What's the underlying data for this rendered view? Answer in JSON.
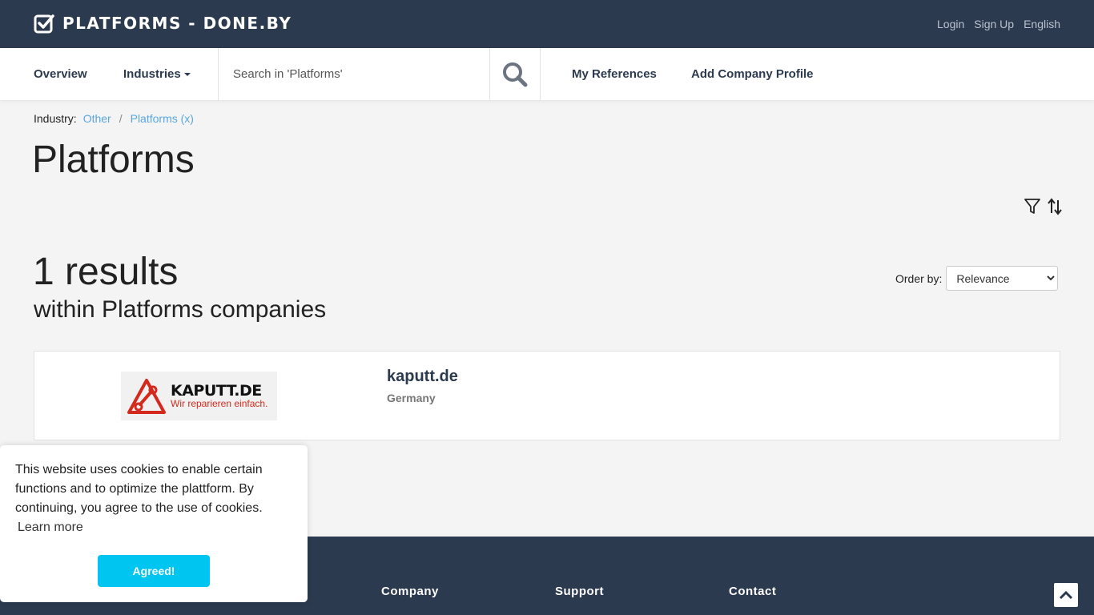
{
  "header": {
    "brand_title": "PLATFORMS - DONE.BY",
    "links": {
      "login": "Login",
      "signup": "Sign Up",
      "language": "English"
    }
  },
  "nav": {
    "overview": "Overview",
    "industries": "Industries",
    "search_placeholder": "Search in 'Platforms'",
    "my_references": "My References",
    "add_company_profile": "Add Company Profile"
  },
  "breadcrumb": {
    "label": "Industry:",
    "items": [
      "Other",
      "Platforms (x)"
    ],
    "separator": "/"
  },
  "page": {
    "title": "Platforms"
  },
  "results": {
    "count": "1 results",
    "subtitle": "within Platforms companies",
    "order_label": "Order by:",
    "order_selected": "Relevance"
  },
  "companies": [
    {
      "logo_main": "KAPUTT.DE",
      "logo_sub": "Wir reparieren einfach.",
      "name": "kaputt.de",
      "country": "Germany"
    }
  ],
  "footer": {
    "columns": [
      "Company",
      "Support",
      "Contact"
    ]
  },
  "cookie": {
    "message": "This website uses cookies to enable certain functions and to optimize the plattform. By continuing, you agree to the use of cookies.",
    "learn_more": "Learn more",
    "accept": "Agreed!"
  },
  "colors": {
    "header_bg": "#2c3a4f",
    "link": "#5aa6e0",
    "accept_button": "#00c5f0",
    "logo_red": "#d42a1e"
  }
}
